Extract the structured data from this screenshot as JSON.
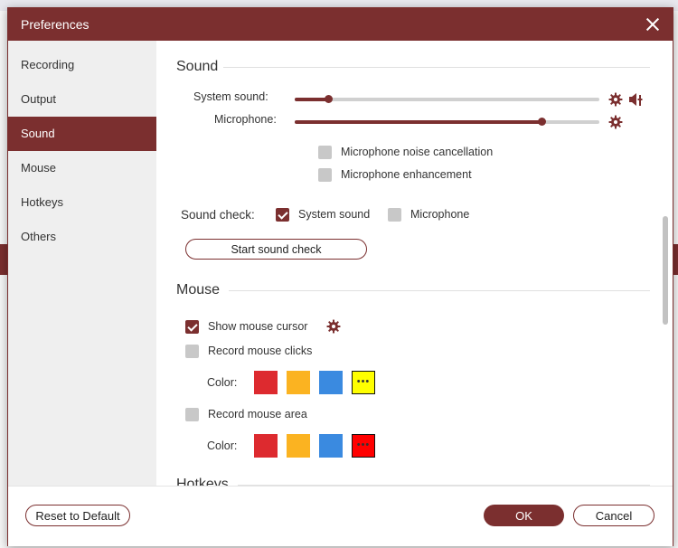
{
  "dialog": {
    "title": "Preferences"
  },
  "sidebar": {
    "items": [
      {
        "label": "Recording"
      },
      {
        "label": "Output"
      },
      {
        "label": "Sound",
        "active": true
      },
      {
        "label": "Mouse"
      },
      {
        "label": "Hotkeys"
      },
      {
        "label": "Others"
      }
    ]
  },
  "sound": {
    "title": "Sound",
    "system_sound_label": "System sound:",
    "system_sound_level": 0.11,
    "microphone_label": "Microphone:",
    "microphone_level": 0.81,
    "noise_cancellation_label": "Microphone noise cancellation",
    "noise_cancellation_checked": false,
    "enhancement_label": "Microphone enhancement",
    "enhancement_checked": false,
    "check_label": "Sound check:",
    "check_system_label": "System sound",
    "check_system_checked": true,
    "check_microphone_label": "Microphone",
    "check_microphone_checked": false,
    "start_button_label": "Start sound check"
  },
  "mouse": {
    "title": "Mouse",
    "show_cursor_label": "Show mouse cursor",
    "show_cursor_checked": true,
    "record_clicks_label": "Record mouse clicks",
    "record_clicks_checked": false,
    "color_label": "Color:",
    "click_colors": [
      "#dd2a2f",
      "#fbb321",
      "#3a8ae0",
      "#ffff00"
    ],
    "record_area_label": "Record mouse area",
    "record_area_checked": false,
    "area_colors": [
      "#dd2a2f",
      "#fbb321",
      "#3a8ae0",
      "#ff0000"
    ],
    "more_dots": "•••"
  },
  "hotkeys": {
    "title": "Hotkeys"
  },
  "footer": {
    "reset_label": "Reset to Default",
    "ok_label": "OK",
    "cancel_label": "Cancel"
  },
  "theme": {
    "accent": "#7b2f2f"
  }
}
